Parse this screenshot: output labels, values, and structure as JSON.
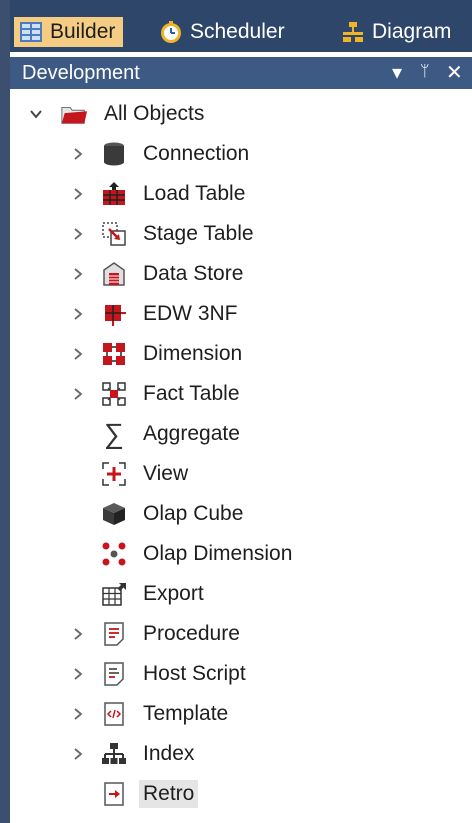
{
  "tabs": [
    {
      "label": "Builder",
      "icon": "builder-icon",
      "active": true
    },
    {
      "label": "Scheduler",
      "icon": "scheduler-icon",
      "active": false
    },
    {
      "label": "Diagram",
      "icon": "diagram-icon",
      "active": false
    }
  ],
  "panel": {
    "title": "Development",
    "controls": {
      "dropdown": "▾",
      "pin": "ᛘ",
      "close": "✕"
    }
  },
  "tree": {
    "root": {
      "label": "All Objects",
      "icon": "folder-icon",
      "expanded": true
    },
    "items": [
      {
        "label": "Connection",
        "icon": "connection-icon",
        "expandable": true
      },
      {
        "label": "Load Table",
        "icon": "load-table-icon",
        "expandable": true
      },
      {
        "label": "Stage Table",
        "icon": "stage-table-icon",
        "expandable": true
      },
      {
        "label": "Data Store",
        "icon": "data-store-icon",
        "expandable": true
      },
      {
        "label": "EDW 3NF",
        "icon": "edw-3nf-icon",
        "expandable": true
      },
      {
        "label": "Dimension",
        "icon": "dimension-icon",
        "expandable": true
      },
      {
        "label": "Fact Table",
        "icon": "fact-table-icon",
        "expandable": true
      },
      {
        "label": "Aggregate",
        "icon": "aggregate-icon",
        "expandable": false
      },
      {
        "label": "View",
        "icon": "view-icon",
        "expandable": false
      },
      {
        "label": "Olap Cube",
        "icon": "olap-cube-icon",
        "expandable": false
      },
      {
        "label": "Olap Dimension",
        "icon": "olap-dimension-icon",
        "expandable": false
      },
      {
        "label": "Export",
        "icon": "export-icon",
        "expandable": false
      },
      {
        "label": "Procedure",
        "icon": "procedure-icon",
        "expandable": true
      },
      {
        "label": "Host Script",
        "icon": "host-script-icon",
        "expandable": true
      },
      {
        "label": "Template",
        "icon": "template-icon",
        "expandable": true
      },
      {
        "label": "Index",
        "icon": "index-icon",
        "expandable": true
      },
      {
        "label": "Retro",
        "icon": "retro-icon",
        "expandable": false,
        "selected": true
      }
    ]
  },
  "colors": {
    "tab_bar": "#2e466a",
    "active_tab": "#f5cc84",
    "panel_header": "#3d5a85",
    "icon_red": "#c4161c",
    "icon_dark": "#3a3a3a"
  }
}
